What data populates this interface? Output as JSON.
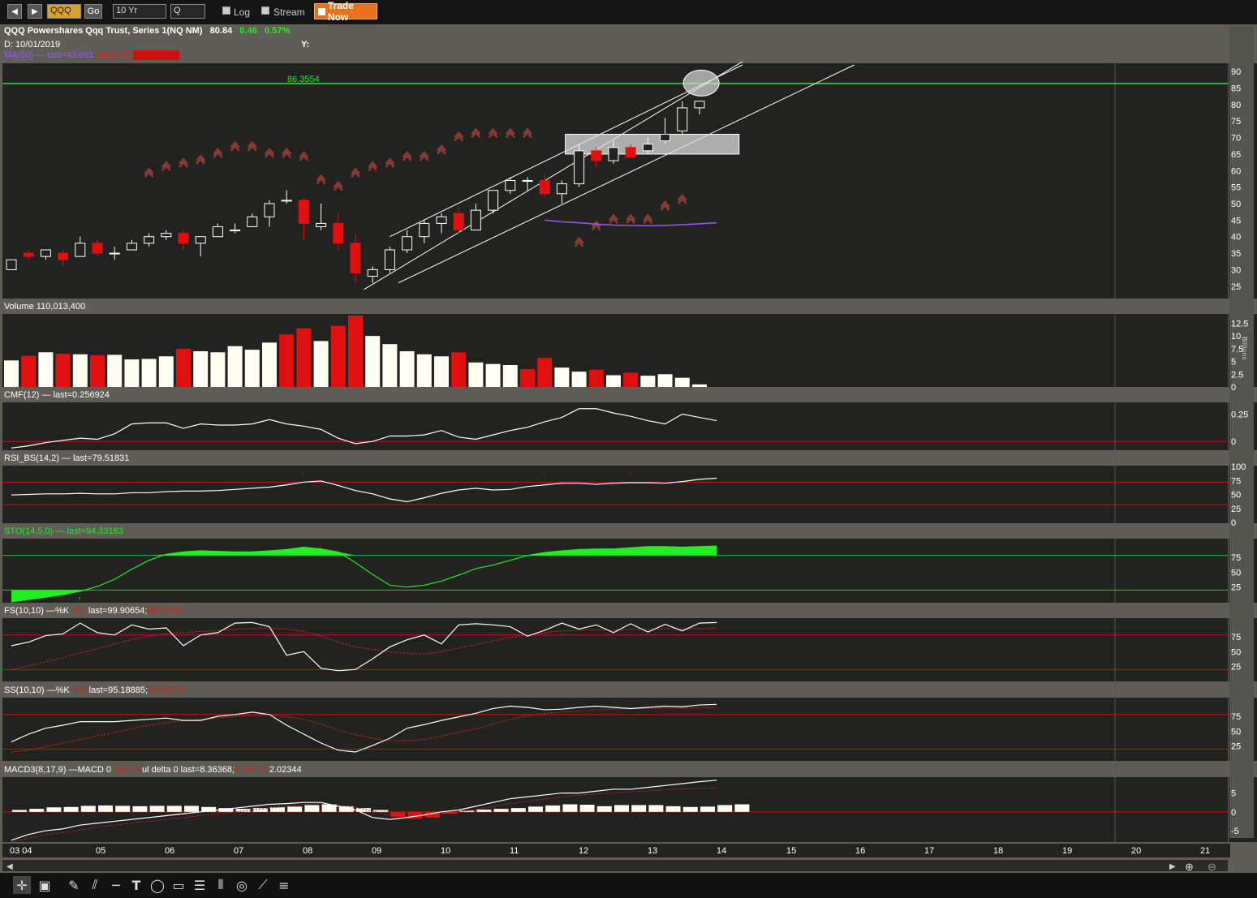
{
  "toolbar": {
    "back_icon": "triangle-left-icon",
    "forward_icon": "triangle-right-icon",
    "symbol_value": "QQQ",
    "go_label": "Go",
    "range_value": "10 Yr",
    "period_value": "Q",
    "log_label": "Log",
    "stream_label": "Stream",
    "trade_label": "Trade Now"
  },
  "header": {
    "symbol_title": "QQQ Powershares Qqq Trust, Series 1(NQ NM)",
    "price": "80.84",
    "change": "0.46",
    "change_pct": "0.57%",
    "date_label": "D: 10/01/2019",
    "y_label": "Y:",
    "ma_legend": "MA(50) — last=43.661",
    "ma200_legend": "MA(200)",
    "ma200_value": "last=0.0000",
    "colors": {
      "up": "#22ee22",
      "ma50": "#9955ff",
      "ma200": "#ee2222"
    }
  },
  "panels": {
    "volume_label": "Volume 110,013,400",
    "volume_unit": "Billions",
    "cmf_label": "CMF(12) — last=0.256924",
    "rsi_label": "RSI_BS(14,2) — last=79.51831",
    "sto_label": "STO(14,5,0) — last=94.33163",
    "fs_label_a": "FS(10,10) —%K",
    "fs_label_b": "%D",
    "fs_label_c": "last=99.90654;",
    "fs_label_d": "89.93354",
    "ss_label_a": "SS(10,10) —%K",
    "ss_label_b": "%D",
    "ss_label_c": "last=95.18885;",
    "ss_label_d": "89.52773",
    "macd_label_a": "MACD3(8,17,9) —MACD 0",
    "macd_label_b": "signal0",
    "macd_label_c": "ul delta 0 last=8.36368;",
    "macd_label_d": "6.34035",
    "macd_label_e": "2.02344"
  },
  "chart_data": [
    {
      "type": "candlestick",
      "title": "QQQ Powershares Qqq Trust, Series 1(NQ NM)",
      "x_labels": [
        "03 04",
        "05",
        "06",
        "07",
        "08",
        "09",
        "10",
        "11",
        "12",
        "13",
        "14",
        "15",
        "16",
        "17",
        "18",
        "19",
        "20",
        "21"
      ],
      "ylim": [
        22,
        92
      ],
      "y_ticks": [
        25,
        30,
        35,
        40,
        45,
        50,
        55,
        60,
        65,
        70,
        75,
        80,
        85,
        90
      ],
      "horizontal_line": {
        "value": 86.3554,
        "label": "86.3554",
        "color": "#22ee22"
      },
      "candles": [
        {
          "o": 30,
          "h": 32,
          "l": 30,
          "c": 33
        },
        {
          "o": 35,
          "h": 36,
          "l": 33,
          "c": 34
        },
        {
          "o": 34,
          "h": 36,
          "l": 33,
          "c": 36
        },
        {
          "o": 35,
          "h": 36,
          "l": 31,
          "c": 33
        },
        {
          "o": 34,
          "h": 40,
          "l": 34,
          "c": 38
        },
        {
          "o": 38,
          "h": 39,
          "l": 34,
          "c": 35
        },
        {
          "o": 35,
          "h": 37,
          "l": 33,
          "c": 35
        },
        {
          "o": 36,
          "h": 39,
          "l": 36,
          "c": 38
        },
        {
          "o": 38,
          "h": 41,
          "l": 37,
          "c": 40
        },
        {
          "o": 40,
          "h": 42,
          "l": 39,
          "c": 41
        },
        {
          "o": 41,
          "h": 42,
          "l": 36,
          "c": 38
        },
        {
          "o": 38,
          "h": 40,
          "l": 34,
          "c": 40
        },
        {
          "o": 40,
          "h": 44,
          "l": 40,
          "c": 43
        },
        {
          "o": 42,
          "h": 44,
          "l": 41,
          "c": 42
        },
        {
          "o": 43,
          "h": 47,
          "l": 43,
          "c": 46
        },
        {
          "o": 46,
          "h": 51,
          "l": 43,
          "c": 50
        },
        {
          "o": 51,
          "h": 54,
          "l": 50,
          "c": 51
        },
        {
          "o": 51,
          "h": 52,
          "l": 39,
          "c": 44
        },
        {
          "o": 43,
          "h": 50,
          "l": 42,
          "c": 44
        },
        {
          "o": 44,
          "h": 47,
          "l": 36,
          "c": 38
        },
        {
          "o": 38,
          "h": 41,
          "l": 26,
          "c": 29
        },
        {
          "o": 28,
          "h": 31,
          "l": 26,
          "c": 30
        },
        {
          "o": 30,
          "h": 37,
          "l": 29,
          "c": 36
        },
        {
          "o": 36,
          "h": 42,
          "l": 35,
          "c": 40
        },
        {
          "o": 40,
          "h": 45,
          "l": 38,
          "c": 44
        },
        {
          "o": 44,
          "h": 47,
          "l": 41,
          "c": 46
        },
        {
          "o": 47,
          "h": 49,
          "l": 41,
          "c": 42
        },
        {
          "o": 42,
          "h": 50,
          "l": 42,
          "c": 48
        },
        {
          "o": 48,
          "h": 54,
          "l": 47,
          "c": 54
        },
        {
          "o": 54,
          "h": 58,
          "l": 53,
          "c": 57
        },
        {
          "o": 57,
          "h": 58,
          "l": 54,
          "c": 57
        },
        {
          "o": 57,
          "h": 59,
          "l": 52,
          "c": 53
        },
        {
          "o": 53,
          "h": 57,
          "l": 50,
          "c": 56
        },
        {
          "o": 56,
          "h": 68,
          "l": 55,
          "c": 66
        },
        {
          "o": 66,
          "h": 67,
          "l": 61,
          "c": 63
        },
        {
          "o": 63,
          "h": 69,
          "l": 62,
          "c": 67
        },
        {
          "o": 67,
          "h": 68,
          "l": 64,
          "c": 64
        },
        {
          "o": 66,
          "h": 70,
          "l": 65,
          "c": 68
        },
        {
          "o": 69,
          "h": 76,
          "l": 68,
          "c": 71
        },
        {
          "o": 72,
          "h": 81,
          "l": 71,
          "c": 79
        },
        {
          "o": 79,
          "h": 81,
          "l": 77,
          "c": 81
        }
      ],
      "ma50": {
        "color": "#9955ff",
        "start_index": 31,
        "values": [
          45,
          44.5,
          44.2,
          43.8,
          43.5,
          43.4,
          43.3,
          43.4,
          43.6,
          43.9,
          44.2
        ]
      },
      "arrows": [
        59,
        61,
        62,
        63,
        65,
        67,
        67,
        65,
        65,
        64,
        57,
        55,
        59,
        61,
        62,
        64,
        64,
        66,
        70,
        71,
        71,
        71,
        71,
        38,
        43,
        45,
        45,
        45,
        49,
        51
      ]
    },
    {
      "type": "bar",
      "title": "Volume 110,013,400",
      "unit": "Billions",
      "ylim": [
        0,
        14
      ],
      "y_ticks": [
        0,
        2.5,
        5,
        7.5,
        10,
        12.5
      ],
      "values": [
        5.2,
        6.1,
        6.8,
        6.5,
        6.4,
        6.2,
        6.3,
        5.4,
        5.5,
        6.0,
        7.5,
        7.0,
        6.8,
        8.0,
        7.3,
        8.7,
        10.3,
        11.5,
        9.0,
        12.0,
        14.0,
        10.0,
        8.4,
        7.0,
        6.4,
        6.0,
        6.8,
        4.8,
        4.5,
        4.3,
        3.5,
        5.7,
        3.8,
        3.0,
        3.4,
        2.3,
        2.8,
        2.2,
        2.5,
        1.8,
        0.5
      ],
      "down_indices": [
        1,
        3,
        5,
        10,
        16,
        17,
        19,
        20,
        26,
        30,
        31,
        34,
        36
      ]
    },
    {
      "type": "line",
      "title": "CMF(12) — last=0.256924",
      "ylim": [
        -0.08,
        0.35
      ],
      "y_ticks": [
        0,
        0.25
      ],
      "baseline": 0,
      "values": [
        -0.06,
        -0.04,
        -0.01,
        0.01,
        0.03,
        0.02,
        0.07,
        0.16,
        0.17,
        0.17,
        0.12,
        0.16,
        0.15,
        0.15,
        0.16,
        0.2,
        0.16,
        0.14,
        0.11,
        0.03,
        -0.02,
        0.0,
        0.05,
        0.05,
        0.06,
        0.1,
        0.04,
        0.02,
        0.06,
        0.1,
        0.13,
        0.18,
        0.22,
        0.3,
        0.3,
        0.26,
        0.23,
        0.19,
        0.16,
        0.25,
        0.22,
        0.19
      ]
    },
    {
      "type": "line",
      "title": "RSI_BS(14,2) — last=79.51831",
      "ylim": [
        0,
        100
      ],
      "y_ticks": [
        0,
        25,
        50,
        75,
        100
      ],
      "reference_lines": [
        72,
        32
      ],
      "values": [
        49,
        50,
        51,
        51,
        52,
        51,
        51,
        53,
        53,
        55,
        56,
        56,
        57,
        59,
        61,
        63,
        67,
        72,
        74,
        66,
        57,
        51,
        42,
        37,
        44,
        52,
        58,
        61,
        58,
        59,
        64,
        67,
        70,
        70,
        68,
        70,
        71,
        71,
        70,
        73,
        77,
        79
      ],
      "markers": [
        17,
        31,
        36
      ]
    },
    {
      "type": "area",
      "title": "STO(14,5,0) — last=94.33163",
      "ylim": [
        0,
        105
      ],
      "y_ticks": [
        25,
        50,
        75
      ],
      "reference_lines": [
        78,
        20
      ],
      "values": [
        0,
        4,
        8,
        12,
        18,
        26,
        38,
        55,
        70,
        80,
        84,
        86,
        85,
        84,
        84,
        86,
        88,
        92,
        89,
        84,
        66,
        46,
        28,
        25,
        28,
        35,
        45,
        56,
        62,
        70,
        78,
        83,
        86,
        88,
        89,
        89,
        91,
        93,
        93,
        92,
        93,
        94
      ],
      "up_markers": [
        4
      ],
      "down_markers": [
        18
      ]
    },
    {
      "type": "line",
      "title": "FS(10,10) —%K %D last=99.90654;89.93354",
      "ylim": [
        0,
        105
      ],
      "y_ticks": [
        25,
        50,
        75
      ],
      "reference_lines": [
        78,
        20
      ],
      "series": [
        {
          "name": "%K",
          "color": "#ffffff",
          "values": [
            60,
            66,
            77,
            80,
            98,
            82,
            78,
            95,
            88,
            90,
            60,
            78,
            82,
            98,
            99,
            92,
            44,
            50,
            22,
            18,
            20,
            38,
            58,
            70,
            78,
            63,
            95,
            97,
            95,
            92,
            76,
            86,
            98,
            88,
            95,
            82,
            97,
            83,
            96,
            85,
            98,
            99
          ]
        },
        {
          "name": "%D",
          "color": "#cc2222",
          "values": [
            20,
            26,
            33,
            40,
            48,
            55,
            63,
            70,
            76,
            80,
            82,
            84,
            85,
            88,
            89,
            90,
            88,
            84,
            76,
            66,
            58,
            54,
            50,
            47,
            46,
            50,
            56,
            62,
            68,
            74,
            78,
            82,
            85,
            86,
            87,
            86,
            88,
            87,
            89,
            88,
            89,
            90
          ]
        }
      ]
    },
    {
      "type": "line",
      "title": "SS(10,10) —%K %D last=95.18885;89.52773",
      "ylim": [
        0,
        105
      ],
      "y_ticks": [
        25,
        50,
        75
      ],
      "reference_lines": [
        78,
        20
      ],
      "series": [
        {
          "name": "%K",
          "color": "#ffffff",
          "values": [
            32,
            45,
            55,
            60,
            66,
            66,
            66,
            68,
            70,
            72,
            68,
            68,
            75,
            78,
            82,
            78,
            60,
            45,
            30,
            18,
            15,
            26,
            38,
            55,
            61,
            68,
            74,
            80,
            88,
            92,
            90,
            86,
            87,
            90,
            92,
            90,
            88,
            90,
            92,
            91,
            94,
            95
          ]
        },
        {
          "name": "%D",
          "color": "#cc2222",
          "values": [
            15,
            18,
            24,
            30,
            36,
            42,
            48,
            54,
            60,
            64,
            68,
            70,
            72,
            75,
            76,
            78,
            74,
            70,
            62,
            52,
            44,
            38,
            34,
            34,
            36,
            42,
            48,
            54,
            62,
            70,
            76,
            80,
            82,
            84,
            86,
            87,
            88,
            88,
            89,
            89,
            89,
            90
          ]
        }
      ]
    },
    {
      "type": "bar",
      "title": "MACD3(8,17,9) —MACD 0 signal0 ul delta 0 last=8.36368;6.34035 2.02344",
      "ylim": [
        -8,
        9
      ],
      "y_ticks": [
        -5,
        0,
        5
      ],
      "histogram": [
        0.5,
        0.8,
        1.2,
        1.3,
        1.6,
        1.7,
        1.6,
        1.5,
        1.6,
        1.6,
        1.6,
        1.3,
        1.0,
        0.8,
        1.0,
        1.2,
        1.4,
        1.8,
        2.0,
        1.5,
        1.0,
        0.5,
        -1.3,
        -1.8,
        -1.5,
        -0.5,
        0.3,
        0.6,
        0.8,
        1.0,
        1.4,
        1.7,
        2.0,
        1.9,
        1.5,
        1.8,
        1.8,
        1.8,
        1.5,
        1.3,
        1.4,
        1.8,
        2.0
      ],
      "macd": [
        -7.5,
        -6,
        -5,
        -4.5,
        -3.5,
        -3,
        -2.5,
        -2,
        -1.5,
        -1,
        -0.5,
        0,
        0.5,
        1,
        1.5,
        2,
        2.2,
        2.5,
        2.5,
        1.5,
        0.5,
        -1.5,
        -2,
        -1.5,
        -0.8,
        0,
        0.5,
        1.5,
        2.5,
        3.5,
        4,
        4.5,
        5,
        5,
        5.5,
        6,
        6,
        6.5,
        7,
        7.5,
        8,
        8.4
      ],
      "signal": [
        -8,
        -7,
        -6,
        -5.5,
        -4.8,
        -4,
        -3.5,
        -3,
        -2.5,
        -2,
        -1.5,
        -1,
        -0.5,
        0,
        0.5,
        1,
        1.5,
        2,
        2.2,
        1.8,
        1.2,
        0.2,
        -0.8,
        -1.2,
        -1,
        -0.5,
        0,
        0.6,
        1.4,
        2.2,
        2.8,
        3.4,
        4,
        4.4,
        4.8,
        5,
        5.3,
        5.6,
        5.9,
        6.1,
        6.3,
        6.3
      ]
    }
  ]
}
